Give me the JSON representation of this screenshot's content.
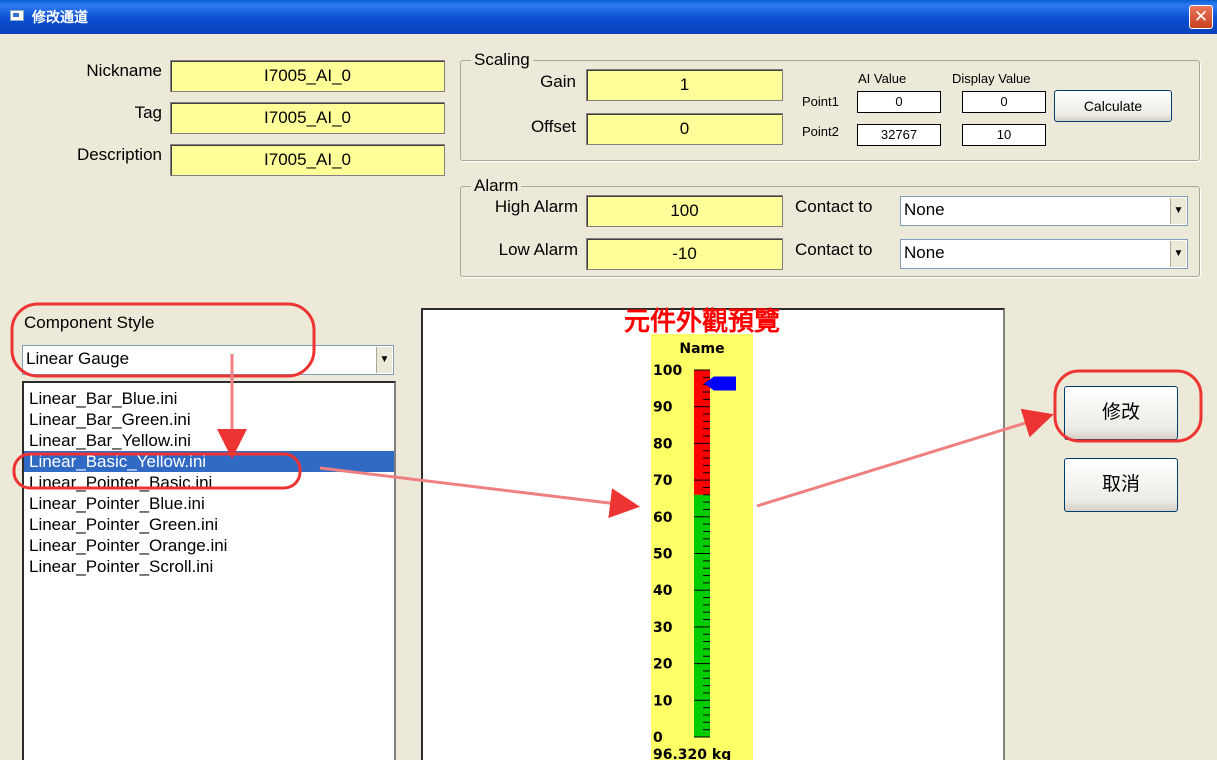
{
  "window": {
    "title": "修改通道",
    "close_glyph": "✕"
  },
  "fields": {
    "nickname": {
      "label": "Nickname",
      "value": "I7005_AI_0"
    },
    "tag": {
      "label": "Tag",
      "value": "I7005_AI_0"
    },
    "description": {
      "label": "Description",
      "value": "I7005_AI_0"
    }
  },
  "scaling": {
    "title": "Scaling",
    "gain_label": "Gain",
    "gain": "1",
    "offset_label": "Offset",
    "offset": "0",
    "ai_value_header": "AI Value",
    "display_value_header": "Display Value",
    "point1_label": "Point1",
    "point1_ai": "0",
    "point1_display": "0",
    "point2_label": "Point2",
    "point2_ai": "32767",
    "point2_display": "10",
    "calculate_label": "Calculate"
  },
  "alarm": {
    "title": "Alarm",
    "high_label": "High Alarm",
    "high": "100",
    "low_label": "Low Alarm",
    "low": "-10",
    "contact_label": "Contact to",
    "high_contact": "None",
    "low_contact": "None"
  },
  "component": {
    "label": "Component Style",
    "style": "Linear Gauge",
    "files": [
      "Linear_Bar_Blue.ini",
      "Linear_Bar_Green.ini",
      "Linear_Bar_Yellow.ini",
      "Linear_Basic_Yellow.ini",
      "Linear_Pointer_Basic.ini",
      "Linear_Pointer_Blue.ini",
      "Linear_Pointer_Green.ini",
      "Linear_Pointer_Orange.ini",
      "Linear_Pointer_Scroll.ini"
    ],
    "selected_index": 3
  },
  "preview": {
    "title": "元件外觀預覽",
    "gauge_name": "Name",
    "ticks": [
      "100",
      "90",
      "80",
      "70",
      "60",
      "50",
      "40",
      "30",
      "20",
      "10",
      "0"
    ],
    "readout": "96.320 kg",
    "pointer_value": 96.32,
    "scale_min": 0,
    "scale_max": 100,
    "red_zone_from": 66,
    "colors": {
      "background": "#ffff66",
      "red": "#ff0000",
      "green": "#00cc00",
      "pointer": "#0000ff"
    }
  },
  "buttons": {
    "modify": "修改",
    "cancel": "取消"
  },
  "annotation_color": "#e33"
}
